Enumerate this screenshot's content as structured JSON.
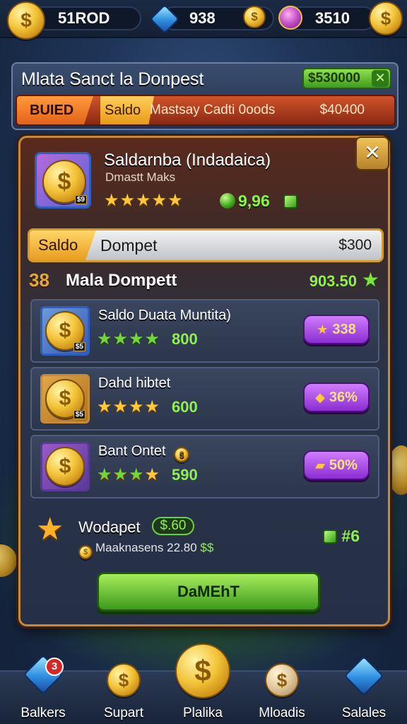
{
  "topbar": {
    "coins": "51ROD",
    "gems": "938",
    "potions": "3510"
  },
  "banner": {
    "title": "Mlata Sanct la Donpest",
    "money": "$530000",
    "strip_tag": "BUIED",
    "strip_saldo": "Saldo",
    "strip_text": "Mastsay Cadti 0oods",
    "strip_amount": "$40400"
  },
  "panel": {
    "hero": {
      "title": "Saldarnba (Indadaica)",
      "subtitle": "Dmastt Maks",
      "thumb_tag": "$9",
      "stars": "★★★★★",
      "value": "9,96"
    },
    "saldo_bar": {
      "tag": "Saldo",
      "label": "Dompet",
      "amount": "$300"
    },
    "section": {
      "number": "38",
      "title": "Mala Dompett",
      "value": "903.50"
    },
    "rows": [
      {
        "title": "Saldo Duata Muntita)",
        "tag": "$5",
        "value": "800",
        "price": "338"
      },
      {
        "title": "Dahd hibtet",
        "tag": "$5",
        "value": "600",
        "price": "36%"
      },
      {
        "title": "Bant Ontet",
        "tag": "",
        "value": "590",
        "price": "50%"
      }
    ],
    "footer": {
      "title": "Wodapet",
      "chip": "$.60",
      "sub": "Maaknasens 22.80",
      "sub_green": "$$",
      "right": "#6"
    },
    "main_button": "DaMEhT"
  },
  "bottom_nav": [
    {
      "label": "Balkers",
      "badge": "3"
    },
    {
      "label": "Supart",
      "badge": ""
    },
    {
      "label": "Plalika",
      "badge": ""
    },
    {
      "label": "Mloadis",
      "badge": ""
    },
    {
      "label": "Salales",
      "badge": ""
    }
  ],
  "colors": {
    "accent_gold": "#ffc83a",
    "accent_green": "#8ff04e",
    "panel_border": "#c8893a",
    "buy_button": "#a64ee0"
  }
}
